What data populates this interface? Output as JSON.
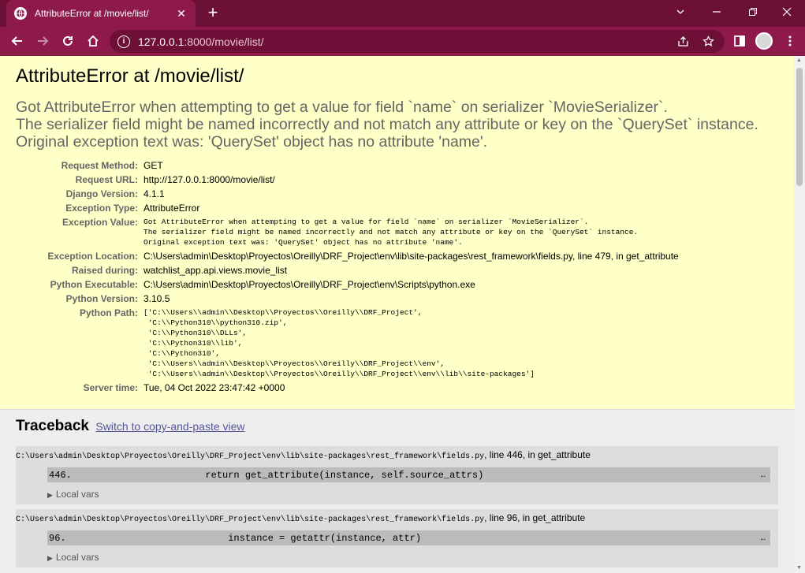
{
  "browser": {
    "tab_title": "AttributeError at /movie/list/",
    "url_host": "127.0.0.1",
    "url_path": ":8000/movie/list/"
  },
  "error": {
    "title": "AttributeError at /movie/list/",
    "message": "Got AttributeError when attempting to get a value for field `name` on serializer `MovieSerializer`.\nThe serializer field might be named incorrectly and not match any attribute or key on the `QuerySet` instance.\nOriginal exception text was: 'QuerySet' object has no attribute 'name'."
  },
  "meta": {
    "request_method_label": "Request Method:",
    "request_method": "GET",
    "request_url_label": "Request URL:",
    "request_url": "http://127.0.0.1:8000/movie/list/",
    "django_version_label": "Django Version:",
    "django_version": "4.1.1",
    "exception_type_label": "Exception Type:",
    "exception_type": "AttributeError",
    "exception_value_label": "Exception Value:",
    "exception_value": "Got AttributeError when attempting to get a value for field `name` on serializer `MovieSerializer`.\nThe serializer field might be named incorrectly and not match any attribute or key on the `QuerySet` instance.\nOriginal exception text was: 'QuerySet' object has no attribute 'name'.",
    "exception_location_label": "Exception Location:",
    "exception_location": "C:\\Users\\admin\\Desktop\\Proyectos\\Oreilly\\DRF_Project\\env\\lib\\site-packages\\rest_framework\\fields.py, line 479, in get_attribute",
    "raised_during_label": "Raised during:",
    "raised_during": "watchlist_app.api.views.movie_list",
    "python_executable_label": "Python Executable:",
    "python_executable": "C:\\Users\\admin\\Desktop\\Proyectos\\Oreilly\\DRF_Project\\env\\Scripts\\python.exe",
    "python_version_label": "Python Version:",
    "python_version": "3.10.5",
    "python_path_label": "Python Path:",
    "python_path": "['C:\\\\Users\\\\admin\\\\Desktop\\\\Proyectos\\\\Oreilly\\\\DRF_Project',\n 'C:\\\\Python310\\\\python310.zip',\n 'C:\\\\Python310\\\\DLLs',\n 'C:\\\\Python310\\\\lib',\n 'C:\\\\Python310',\n 'C:\\\\Users\\\\admin\\\\Desktop\\\\Proyectos\\\\Oreilly\\\\DRF_Project\\\\env',\n 'C:\\\\Users\\\\admin\\\\Desktop\\\\Proyectos\\\\Oreilly\\\\DRF_Project\\\\env\\\\lib\\\\site-packages']",
    "server_time_label": "Server time:",
    "server_time": "Tue, 04 Oct 2022 23:47:42 +0000"
  },
  "traceback": {
    "heading": "Traceback",
    "switch_link": "Switch to copy-and-paste view",
    "frames": [
      {
        "path": "C:\\Users\\admin\\Desktop\\Proyectos\\Oreilly\\DRF_Project\\env\\lib\\site-packages\\rest_framework\\fields.py",
        "where": ", line 446, in get_attribute",
        "lineno": "446.",
        "code": "            return get_attribute(instance, self.source_attrs)",
        "ellipsis": "…",
        "local_vars": "Local vars"
      },
      {
        "path": "C:\\Users\\admin\\Desktop\\Proyectos\\Oreilly\\DRF_Project\\env\\lib\\site-packages\\rest_framework\\fields.py",
        "where": ", line 96, in get_attribute",
        "lineno": "96.",
        "code": "                instance = getattr(instance, attr)",
        "ellipsis": "…",
        "local_vars": "Local vars"
      }
    ]
  }
}
